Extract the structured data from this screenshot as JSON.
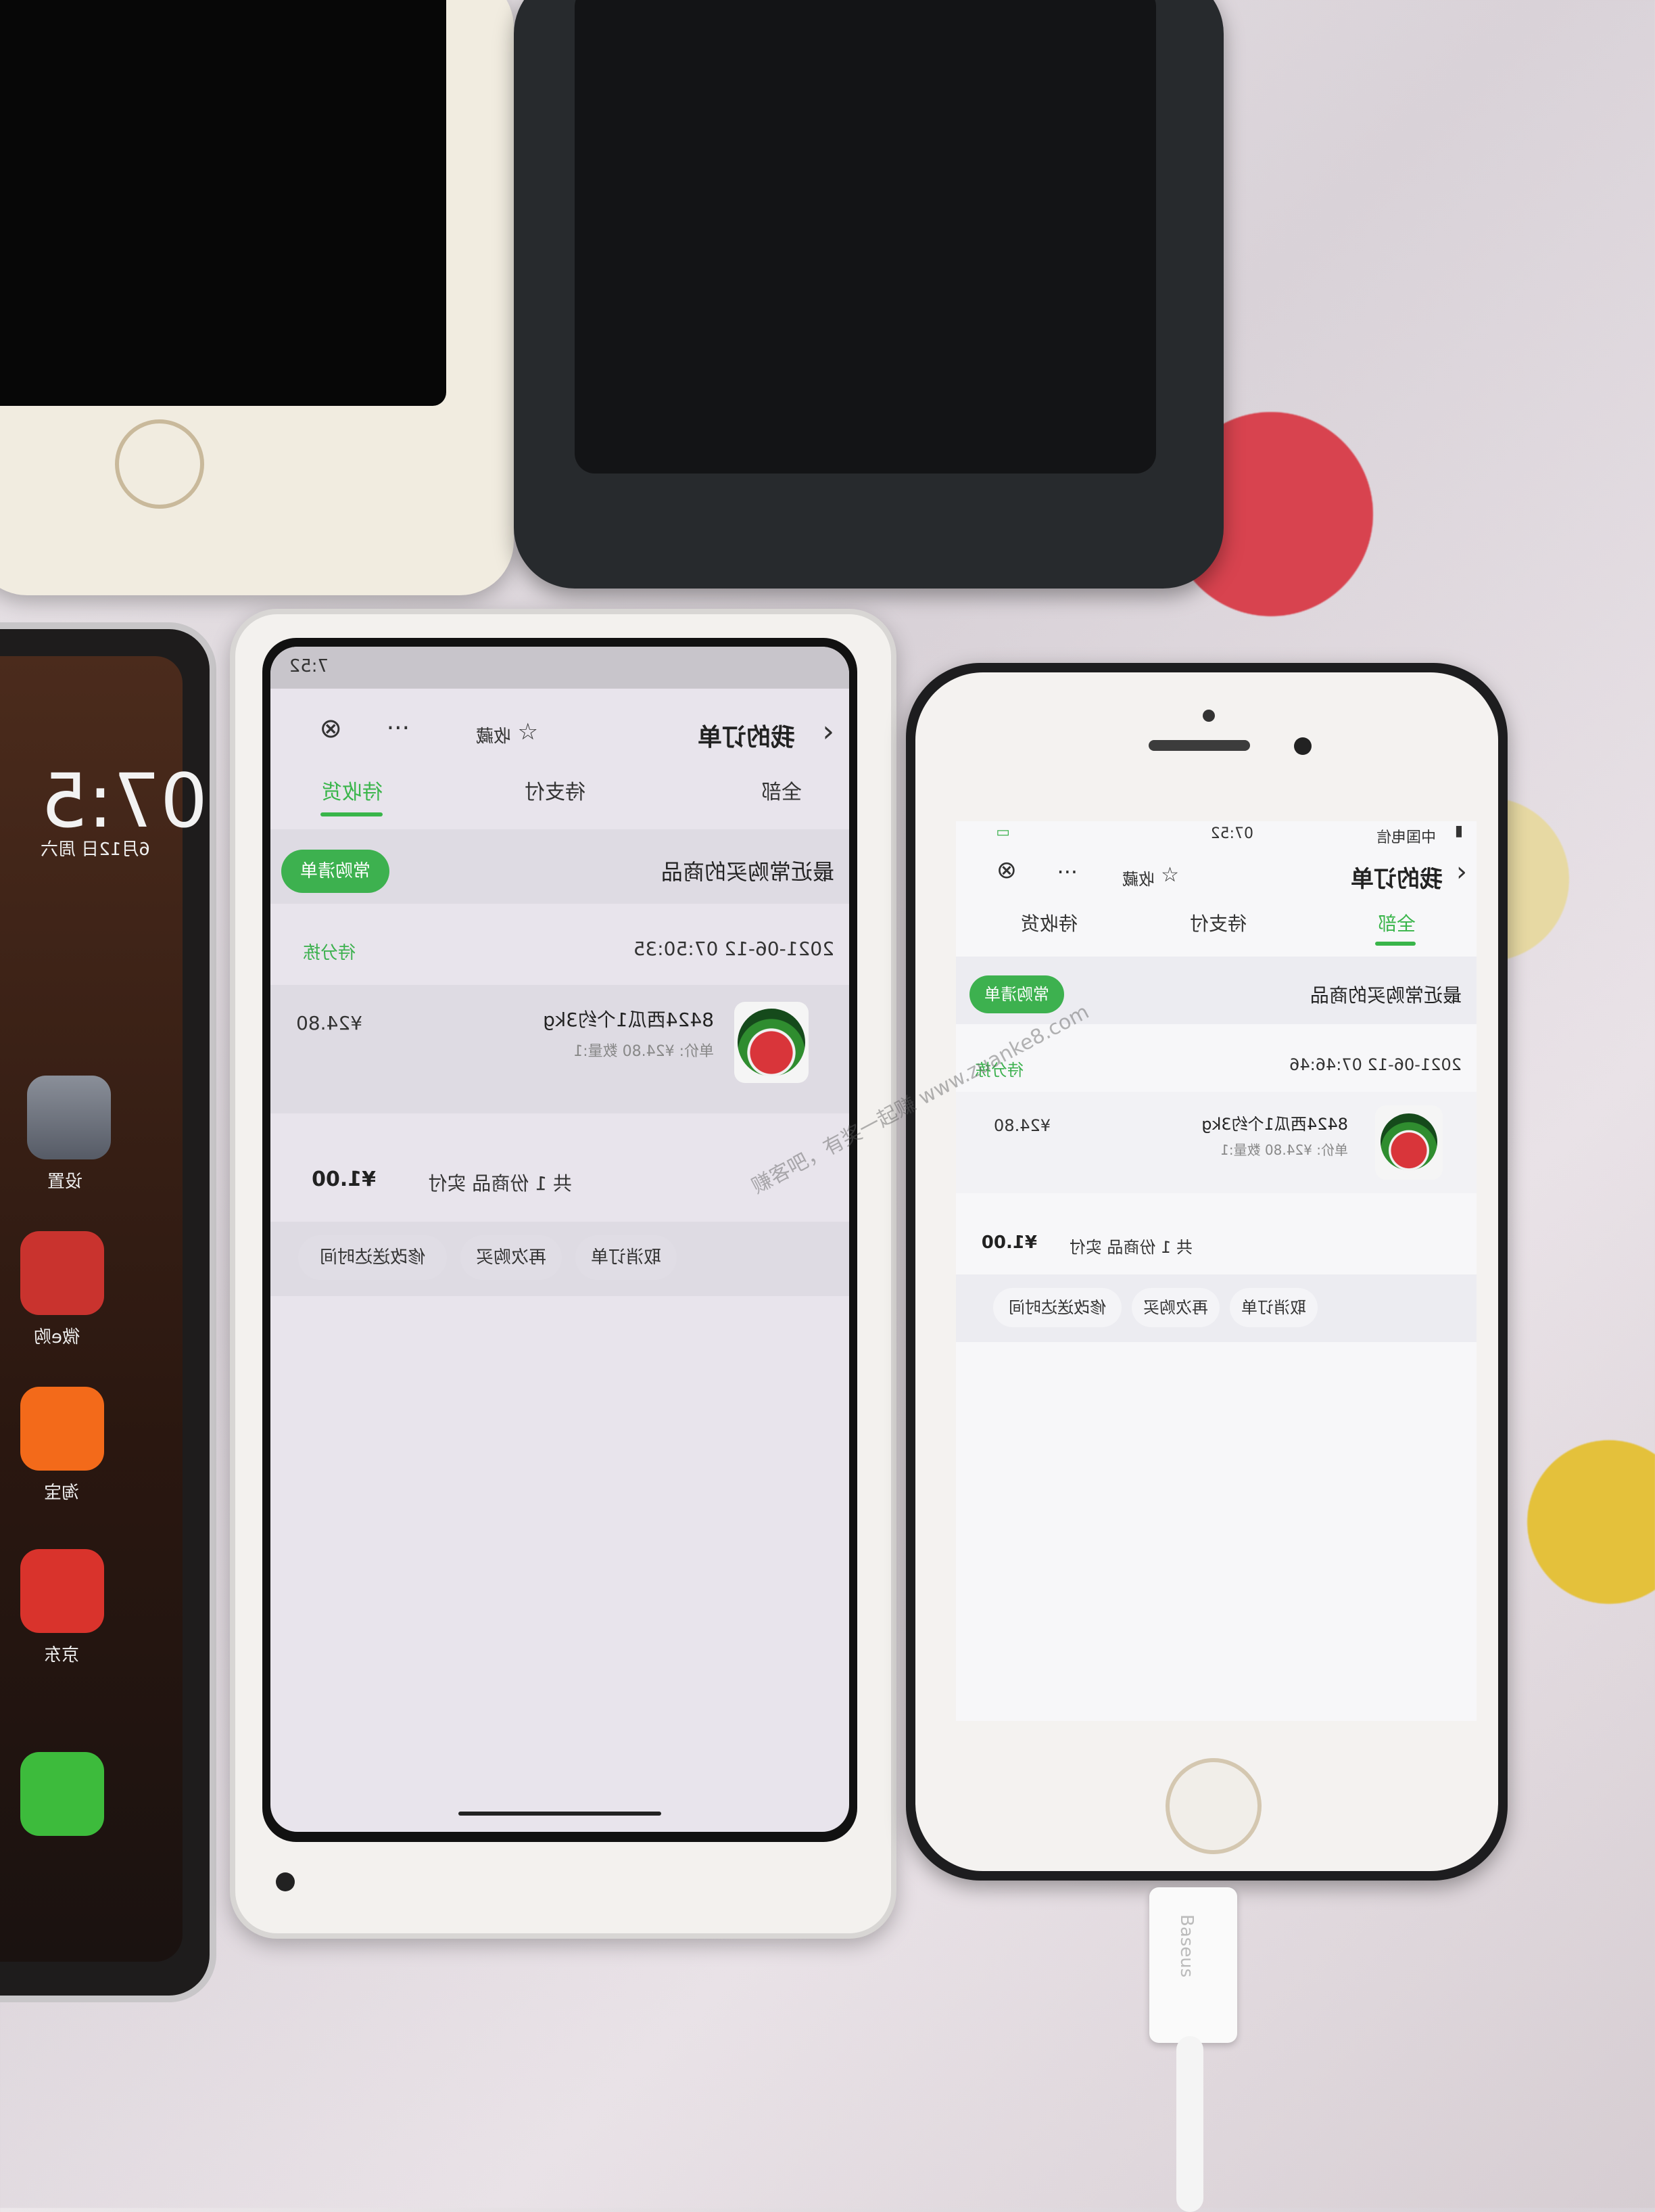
{
  "apps": {
    "lock_time": "07:5",
    "lock_date": "6月12日 周六",
    "settings": "设置",
    "weibo": "微e购",
    "taobao": "淘宝",
    "jd": "京东"
  },
  "phoneA": {
    "status_time": "7:52",
    "favorite": "收藏",
    "title": "我的订单",
    "tabs": [
      "全部",
      "待支付",
      "待收货"
    ],
    "recent_title": "最近常购买的商品",
    "list_pill": "常购清单",
    "order_time": "2021-06-12 07:50:35",
    "order_status": "待分拣",
    "product_name": "8424西瓜1个约3kg",
    "product_meta": "单价: ¥24.80 数量:1",
    "product_price": "¥24.80",
    "summary": "共 1 份商品 实付",
    "paid": "¥1.00",
    "buttons": [
      "取消订单",
      "再次购买",
      "修改送达时间"
    ]
  },
  "phoneB": {
    "status_time": "07:52",
    "carrier": "中国电信",
    "favorite": "收藏",
    "title": "我的订单",
    "tabs": [
      "全部",
      "待支付",
      "待收货"
    ],
    "recent_title": "最近常购买的商品",
    "list_pill": "常购清单",
    "order_time": "2021-06-12 07:46:46",
    "order_status": "待分拣",
    "product_name": "8424西瓜1个约3kg",
    "product_meta": "单价: ¥24.80 数量:1",
    "product_price": "¥24.80",
    "summary": "共 1 份商品 实付",
    "paid": "¥1.00",
    "buttons": [
      "取消订单",
      "再次购买",
      "修改送达时间"
    ]
  },
  "watermark": "赚客吧，有奖一起赚 www.zuanke8.com",
  "cable_brand": "Baseus",
  "colors": {
    "accent_green": "#3db14f",
    "melon_red": "#d9353a"
  }
}
